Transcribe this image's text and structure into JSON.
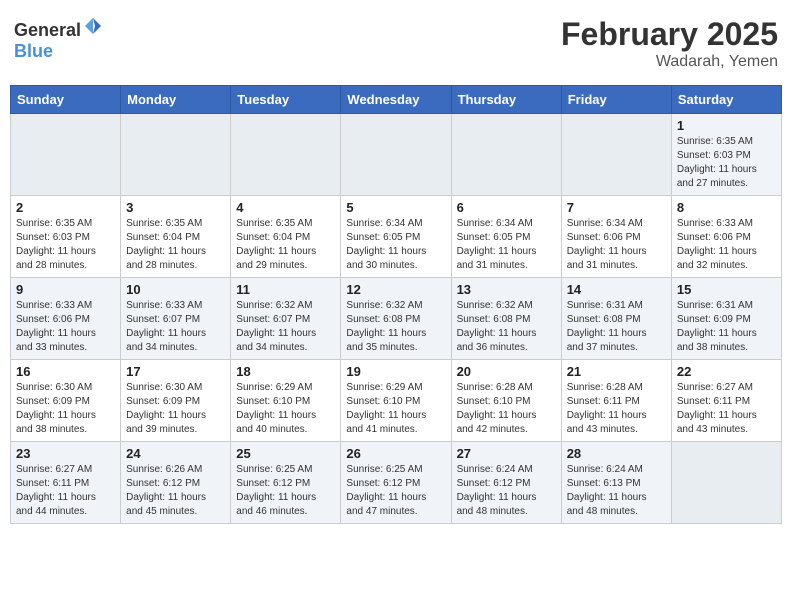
{
  "header": {
    "logo_general": "General",
    "logo_blue": "Blue",
    "title": "February 2025",
    "subtitle": "Wadarah, Yemen"
  },
  "weekdays": [
    "Sunday",
    "Monday",
    "Tuesday",
    "Wednesday",
    "Thursday",
    "Friday",
    "Saturday"
  ],
  "weeks": [
    [
      {
        "day": "",
        "info": ""
      },
      {
        "day": "",
        "info": ""
      },
      {
        "day": "",
        "info": ""
      },
      {
        "day": "",
        "info": ""
      },
      {
        "day": "",
        "info": ""
      },
      {
        "day": "",
        "info": ""
      },
      {
        "day": "1",
        "info": "Sunrise: 6:35 AM\nSunset: 6:03 PM\nDaylight: 11 hours and 27 minutes."
      }
    ],
    [
      {
        "day": "2",
        "info": "Sunrise: 6:35 AM\nSunset: 6:03 PM\nDaylight: 11 hours and 28 minutes."
      },
      {
        "day": "3",
        "info": "Sunrise: 6:35 AM\nSunset: 6:04 PM\nDaylight: 11 hours and 28 minutes."
      },
      {
        "day": "4",
        "info": "Sunrise: 6:35 AM\nSunset: 6:04 PM\nDaylight: 11 hours and 29 minutes."
      },
      {
        "day": "5",
        "info": "Sunrise: 6:34 AM\nSunset: 6:05 PM\nDaylight: 11 hours and 30 minutes."
      },
      {
        "day": "6",
        "info": "Sunrise: 6:34 AM\nSunset: 6:05 PM\nDaylight: 11 hours and 31 minutes."
      },
      {
        "day": "7",
        "info": "Sunrise: 6:34 AM\nSunset: 6:06 PM\nDaylight: 11 hours and 31 minutes."
      },
      {
        "day": "8",
        "info": "Sunrise: 6:33 AM\nSunset: 6:06 PM\nDaylight: 11 hours and 32 minutes."
      }
    ],
    [
      {
        "day": "9",
        "info": "Sunrise: 6:33 AM\nSunset: 6:06 PM\nDaylight: 11 hours and 33 minutes."
      },
      {
        "day": "10",
        "info": "Sunrise: 6:33 AM\nSunset: 6:07 PM\nDaylight: 11 hours and 34 minutes."
      },
      {
        "day": "11",
        "info": "Sunrise: 6:32 AM\nSunset: 6:07 PM\nDaylight: 11 hours and 34 minutes."
      },
      {
        "day": "12",
        "info": "Sunrise: 6:32 AM\nSunset: 6:08 PM\nDaylight: 11 hours and 35 minutes."
      },
      {
        "day": "13",
        "info": "Sunrise: 6:32 AM\nSunset: 6:08 PM\nDaylight: 11 hours and 36 minutes."
      },
      {
        "day": "14",
        "info": "Sunrise: 6:31 AM\nSunset: 6:08 PM\nDaylight: 11 hours and 37 minutes."
      },
      {
        "day": "15",
        "info": "Sunrise: 6:31 AM\nSunset: 6:09 PM\nDaylight: 11 hours and 38 minutes."
      }
    ],
    [
      {
        "day": "16",
        "info": "Sunrise: 6:30 AM\nSunset: 6:09 PM\nDaylight: 11 hours and 38 minutes."
      },
      {
        "day": "17",
        "info": "Sunrise: 6:30 AM\nSunset: 6:09 PM\nDaylight: 11 hours and 39 minutes."
      },
      {
        "day": "18",
        "info": "Sunrise: 6:29 AM\nSunset: 6:10 PM\nDaylight: 11 hours and 40 minutes."
      },
      {
        "day": "19",
        "info": "Sunrise: 6:29 AM\nSunset: 6:10 PM\nDaylight: 11 hours and 41 minutes."
      },
      {
        "day": "20",
        "info": "Sunrise: 6:28 AM\nSunset: 6:10 PM\nDaylight: 11 hours and 42 minutes."
      },
      {
        "day": "21",
        "info": "Sunrise: 6:28 AM\nSunset: 6:11 PM\nDaylight: 11 hours and 43 minutes."
      },
      {
        "day": "22",
        "info": "Sunrise: 6:27 AM\nSunset: 6:11 PM\nDaylight: 11 hours and 43 minutes."
      }
    ],
    [
      {
        "day": "23",
        "info": "Sunrise: 6:27 AM\nSunset: 6:11 PM\nDaylight: 11 hours and 44 minutes."
      },
      {
        "day": "24",
        "info": "Sunrise: 6:26 AM\nSunset: 6:12 PM\nDaylight: 11 hours and 45 minutes."
      },
      {
        "day": "25",
        "info": "Sunrise: 6:25 AM\nSunset: 6:12 PM\nDaylight: 11 hours and 46 minutes."
      },
      {
        "day": "26",
        "info": "Sunrise: 6:25 AM\nSunset: 6:12 PM\nDaylight: 11 hours and 47 minutes."
      },
      {
        "day": "27",
        "info": "Sunrise: 6:24 AM\nSunset: 6:12 PM\nDaylight: 11 hours and 48 minutes."
      },
      {
        "day": "28",
        "info": "Sunrise: 6:24 AM\nSunset: 6:13 PM\nDaylight: 11 hours and 48 minutes."
      },
      {
        "day": "",
        "info": ""
      }
    ]
  ]
}
